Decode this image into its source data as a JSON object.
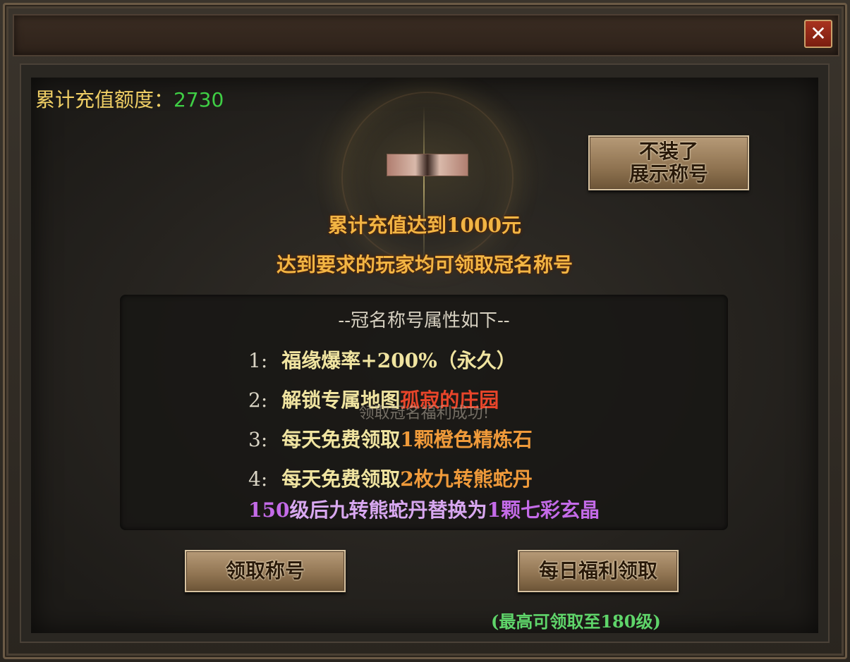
{
  "window": {
    "close_symbol": "✕"
  },
  "recharge": {
    "label": "累计充值额度：",
    "value": "2730"
  },
  "hide_title_button": {
    "line1": "不装了",
    "line2": "展示称号"
  },
  "requirement": {
    "line1": "累计充值达到1000元",
    "line2": "达到要求的玩家均可领取冠名称号"
  },
  "attributes": {
    "header": "--冠名称号属性如下--",
    "items": [
      {
        "num": "1:",
        "text": "福缘爆率+200%（永久）"
      },
      {
        "num": "2:",
        "prefix": "解锁专属地图",
        "highlight": "孤寂的庄园"
      },
      {
        "num": "3:",
        "prefix": "每天免费领取",
        "highlight": "1颗橙色精炼石"
      },
      {
        "num": "4:",
        "prefix": "每天免费领取",
        "highlight": "2枚九转熊蛇丹"
      }
    ],
    "note": {
      "prefix": "150",
      "middle": "级后九转熊蛇丹替换为",
      "suffix": "1颗七彩玄晶"
    }
  },
  "toast": "领取冠名福利成功!",
  "buttons": {
    "claim_title": "领取称号",
    "daily_claim": "每日福利领取"
  },
  "max_level_note": "(最高可领取至180级)",
  "colors": {
    "gold": "#f0cf65",
    "green": "#3fcf45",
    "orange": "#f2b544",
    "red": "#e8452a",
    "violet": "#c46be8"
  }
}
